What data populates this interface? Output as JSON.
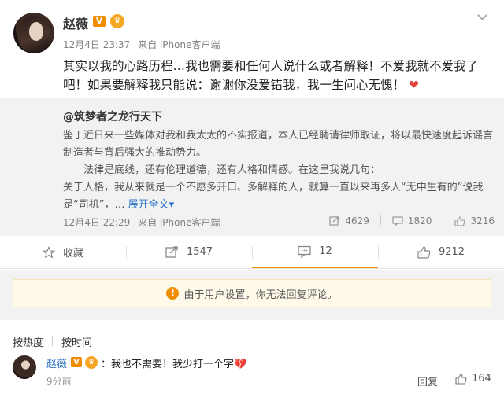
{
  "post": {
    "username": "赵薇",
    "vip_badge": "V",
    "level_badge": "♛",
    "date": "12月4日 23:37",
    "source": "来自 iPhone客户端",
    "text": "其实以我的心路历程…我也需要和任何人说什么或者解释！不爱我就不爱我了吧！如果要解释我只能说：谢谢你没爱错我，我一生问心无愧！",
    "heart": "❤"
  },
  "repost": {
    "author": "@筑梦者之龙行天下",
    "paragraph1": "鉴于近日来一些媒体对我和我太太的不实报道，本人已经聘请律师取证，将以最快速度起诉谣言制造者与背后强大的推动势力。",
    "paragraph2": "法律是底线，还有伦理道德，还有人格和情感。在这里我说几句：",
    "paragraph3": "关于人格，我从来就是一个不愿多开口、多解释的人，就算一直以来再多人“无中生有的”说我是“司机”，…",
    "expand": "展开全文",
    "expand_arrow": "▾",
    "date": "12月4日 22:29",
    "source": "来自 iPhone客户端",
    "reposts": "4629",
    "comments": "1820",
    "likes": "3216"
  },
  "actions": {
    "favorite": "收藏",
    "repost": "1547",
    "comment": "12",
    "like": "9212"
  },
  "notice": {
    "icon": "!",
    "text": "由于用户设置，你无法回复评论。"
  },
  "sort": {
    "hot": "按热度",
    "time": "按时间"
  },
  "comment": {
    "username": "赵薇",
    "vip_badge": "V",
    "level_badge": "♛",
    "text": "：我也不需要！我少打一个字",
    "emoji": "💔",
    "time": "9分前",
    "reply": "回复",
    "likes": "164"
  },
  "colors": {
    "accent": "#f08c00",
    "link": "#2b74c5",
    "heart": "#e0443a"
  }
}
